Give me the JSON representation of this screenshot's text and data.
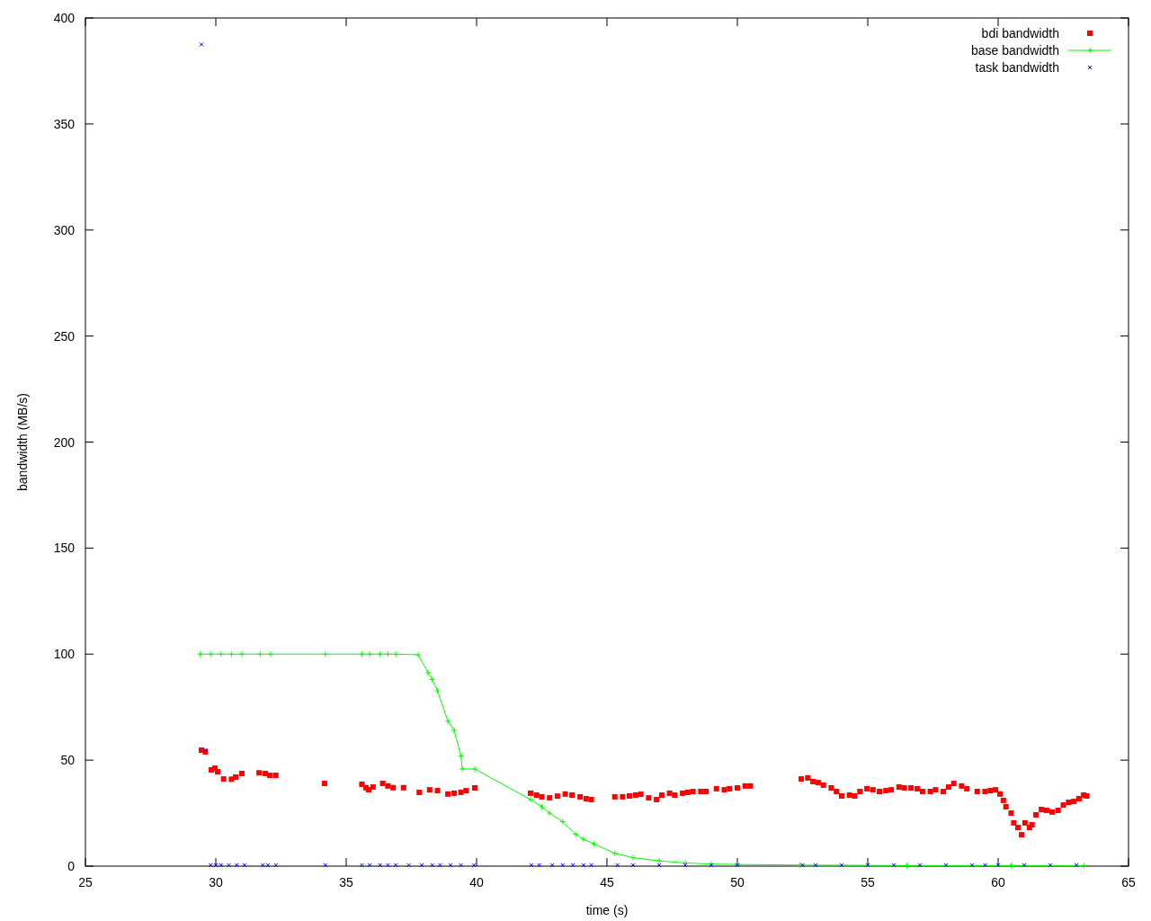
{
  "chart_data": {
    "type": "scatter",
    "legend": true,
    "xlabel": "time (s)",
    "ylabel": "bandwidth (MB/s)",
    "xlim": [
      25,
      65
    ],
    "ylim": [
      0,
      400
    ],
    "xticks": [
      {
        "value": 25,
        "label": "25"
      },
      {
        "value": 30,
        "label": "30"
      },
      {
        "value": 35,
        "label": "35"
      },
      {
        "value": 40,
        "label": "40"
      },
      {
        "value": 45,
        "label": "45"
      },
      {
        "value": 50,
        "label": "50"
      },
      {
        "value": 55,
        "label": "55"
      },
      {
        "value": 60,
        "label": "60"
      },
      {
        "value": 65,
        "label": "65"
      }
    ],
    "yticks": [
      {
        "value": 0,
        "label": "0"
      },
      {
        "value": 50,
        "label": "50"
      },
      {
        "value": 100,
        "label": "100"
      },
      {
        "value": 150,
        "label": "150"
      },
      {
        "value": 200,
        "label": "200"
      },
      {
        "value": 250,
        "label": "250"
      },
      {
        "value": 300,
        "label": "300"
      },
      {
        "value": 350,
        "label": "350"
      },
      {
        "value": 400,
        "label": "400"
      }
    ],
    "series": [
      {
        "name": "bdi bandwidth",
        "color": "#ff0000",
        "marker": "square",
        "x": [
          29.45,
          29.6,
          29.83,
          29.97,
          30.07,
          30.3,
          30.6,
          30.76,
          31,
          31.66,
          31.9,
          32.07,
          32.3,
          34.17,
          35.6,
          35.76,
          35.86,
          36.03,
          36.4,
          36.6,
          36.8,
          37.2,
          37.8,
          38.2,
          38.5,
          38.9,
          39.14,
          39.4,
          39.6,
          39.93,
          42.07,
          42.3,
          42.5,
          42.8,
          43.1,
          43.4,
          43.66,
          43.97,
          44.2,
          44.4,
          45.3,
          45.6,
          45.86,
          46.1,
          46.3,
          46.6,
          46.9,
          47.1,
          47.4,
          47.6,
          47.9,
          48.1,
          48.3,
          48.6,
          48.8,
          49.2,
          49.5,
          49.7,
          50,
          50.3,
          50.5,
          52.45,
          52.7,
          52.9,
          53.1,
          53.3,
          53.6,
          53.8,
          54,
          54.3,
          54.5,
          54.7,
          54.97,
          55.2,
          55.45,
          55.7,
          55.9,
          56.2,
          56.4,
          56.66,
          56.9,
          57.1,
          57.4,
          57.6,
          57.9,
          58.1,
          58.3,
          58.6,
          58.8,
          59.2,
          59.5,
          59.7,
          59.9,
          60.07,
          60.2,
          60.3,
          60.5,
          60.6,
          60.76,
          60.9,
          61.03,
          61.2,
          61.3,
          61.45,
          61.66,
          61.86,
          62.07,
          62.3,
          62.5,
          62.7,
          62.9,
          63.1,
          63.28,
          63.4
        ],
        "values": [
          54.7,
          53.9,
          45.4,
          46.2,
          44.5,
          41.1,
          41,
          42,
          43.7,
          44,
          43.7,
          42.8,
          42.8,
          39,
          38.6,
          37,
          36,
          37.3,
          39,
          37.8,
          37,
          37,
          34.8,
          36,
          35.6,
          34,
          34.4,
          34.8,
          35.6,
          36.9,
          34.4,
          33.5,
          32.7,
          32.2,
          33,
          34,
          33.5,
          32.7,
          31.8,
          31.4,
          32.7,
          32.7,
          33.1,
          33.5,
          33.9,
          32.2,
          31.4,
          33.5,
          34.4,
          33.5,
          34.4,
          34.8,
          35.2,
          35.2,
          35.2,
          36.5,
          36,
          36.5,
          36.9,
          37.8,
          37.8,
          41.1,
          41.6,
          39.9,
          39.4,
          38.2,
          36.9,
          35.2,
          33.1,
          33.5,
          33.1,
          35.2,
          36.5,
          36,
          35.2,
          35.6,
          36,
          37.3,
          36.9,
          36.9,
          36.5,
          35.2,
          35.2,
          36,
          35.2,
          37.3,
          39,
          37.8,
          36.5,
          35.2,
          35.2,
          35.6,
          36,
          34,
          31,
          28,
          25,
          20.4,
          18.2,
          14.8,
          20.4,
          18.2,
          19.5,
          24.2,
          26.7,
          26.3,
          25.5,
          26.3,
          28.8,
          30.1,
          30.5,
          31.8,
          33.5,
          33.1
        ]
      },
      {
        "name": "base bandwidth",
        "color": "#00ff00",
        "type": "line",
        "marker": "plus",
        "x": [
          29.4,
          29.8,
          30.2,
          30.6,
          31,
          31.7,
          32.1,
          34.2,
          35.6,
          35.9,
          36.3,
          36.6,
          36.9,
          37.76,
          38.14,
          38.3,
          38.5,
          38.9,
          39.14,
          39.4,
          39.45,
          39.93,
          42.07,
          42.5,
          42.8,
          43.3,
          43.8,
          44.1,
          44.5,
          45.3,
          46,
          47,
          48,
          49,
          50,
          52.4,
          56.5,
          60.5,
          63.3
        ],
        "values": [
          100,
          100,
          100,
          100,
          100,
          100,
          100,
          100,
          100,
          100,
          100,
          100,
          100,
          99.7,
          91.2,
          88,
          82.7,
          68.3,
          64,
          52,
          45.8,
          45.8,
          31.4,
          28,
          25,
          21,
          15,
          12.7,
          10.5,
          6,
          4,
          2.5,
          1.5,
          1,
          0.8,
          0.5,
          0.3,
          0.3,
          0.3
        ]
      },
      {
        "name": "task bandwidth",
        "color": "#0000ff",
        "marker": "cross",
        "x": [
          29.45,
          29.6,
          29.8,
          30,
          30.2,
          30.5,
          30.8,
          31.1,
          31.8,
          32,
          32.3,
          34.2,
          35.6,
          35.9,
          36.3,
          36.6,
          36.9,
          37.4,
          37.9,
          38.3,
          38.6,
          39,
          39.4,
          39.9,
          42.1,
          42.4,
          42.9,
          43.3,
          43.7,
          44.1,
          44.4,
          45.4,
          46,
          47,
          48,
          49,
          50,
          52.5,
          53,
          54,
          55,
          56,
          57,
          58,
          59,
          59.5,
          60,
          61,
          62,
          63
        ],
        "values": [
          387.5,
          54.7,
          0.5,
          0.5,
          0.5,
          0.5,
          0.5,
          0.5,
          0.5,
          0.5,
          0.5,
          0.5,
          0.5,
          0.5,
          0.5,
          0.5,
          0.5,
          0.5,
          0.5,
          0.5,
          0.5,
          0.5,
          0.5,
          0.5,
          0.5,
          0.5,
          0.5,
          0.5,
          0.5,
          0.5,
          0.5,
          0.5,
          0.5,
          0.5,
          0.5,
          0.5,
          0.5,
          0.5,
          0.5,
          0.5,
          0.5,
          0.5,
          0.5,
          0.5,
          0.5,
          0.5,
          0.5,
          0.5,
          0.5,
          0.5
        ]
      }
    ]
  }
}
